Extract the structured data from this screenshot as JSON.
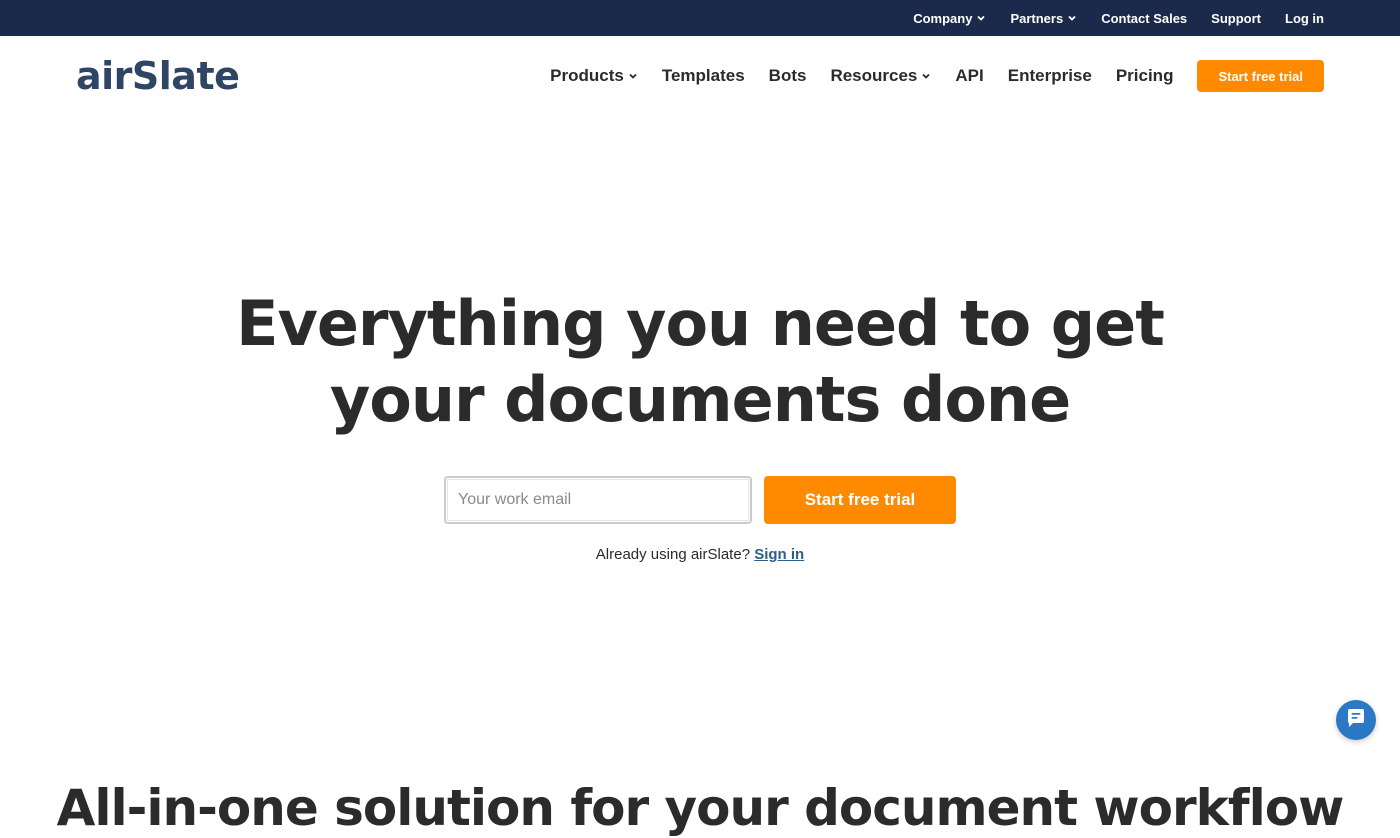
{
  "topbar": {
    "items": [
      {
        "label": "Company",
        "dropdown": true
      },
      {
        "label": "Partners",
        "dropdown": true
      },
      {
        "label": "Contact Sales",
        "dropdown": false
      },
      {
        "label": "Support",
        "dropdown": false
      },
      {
        "label": "Log in",
        "dropdown": false
      }
    ]
  },
  "header": {
    "logo": "airSlate",
    "nav": [
      {
        "label": "Products",
        "dropdown": true
      },
      {
        "label": "Templates",
        "dropdown": false
      },
      {
        "label": "Bots",
        "dropdown": false
      },
      {
        "label": "Resources",
        "dropdown": true
      },
      {
        "label": "API",
        "dropdown": false
      },
      {
        "label": "Enterprise",
        "dropdown": false
      },
      {
        "label": "Pricing",
        "dropdown": false
      }
    ],
    "cta_label": "Start free trial"
  },
  "hero": {
    "title_line1": "Everything you need to get",
    "title_line2": "your documents done",
    "email_placeholder": "Your work email",
    "cta_label": "Start free trial",
    "signin_prefix": "Already using airSlate?",
    "signin_link": "Sign in"
  },
  "section": {
    "title": "All-in-one solution for your document workflow"
  },
  "colors": {
    "topbar_bg": "#1b2a4a",
    "accent_orange": "#ff8a00",
    "logo_blue": "#2f4564",
    "chat_blue": "#2b78c5",
    "link_blue": "#2f5f86"
  },
  "icons": {
    "dropdown": "chevron-down-icon",
    "chat": "chat-bubble-icon"
  }
}
